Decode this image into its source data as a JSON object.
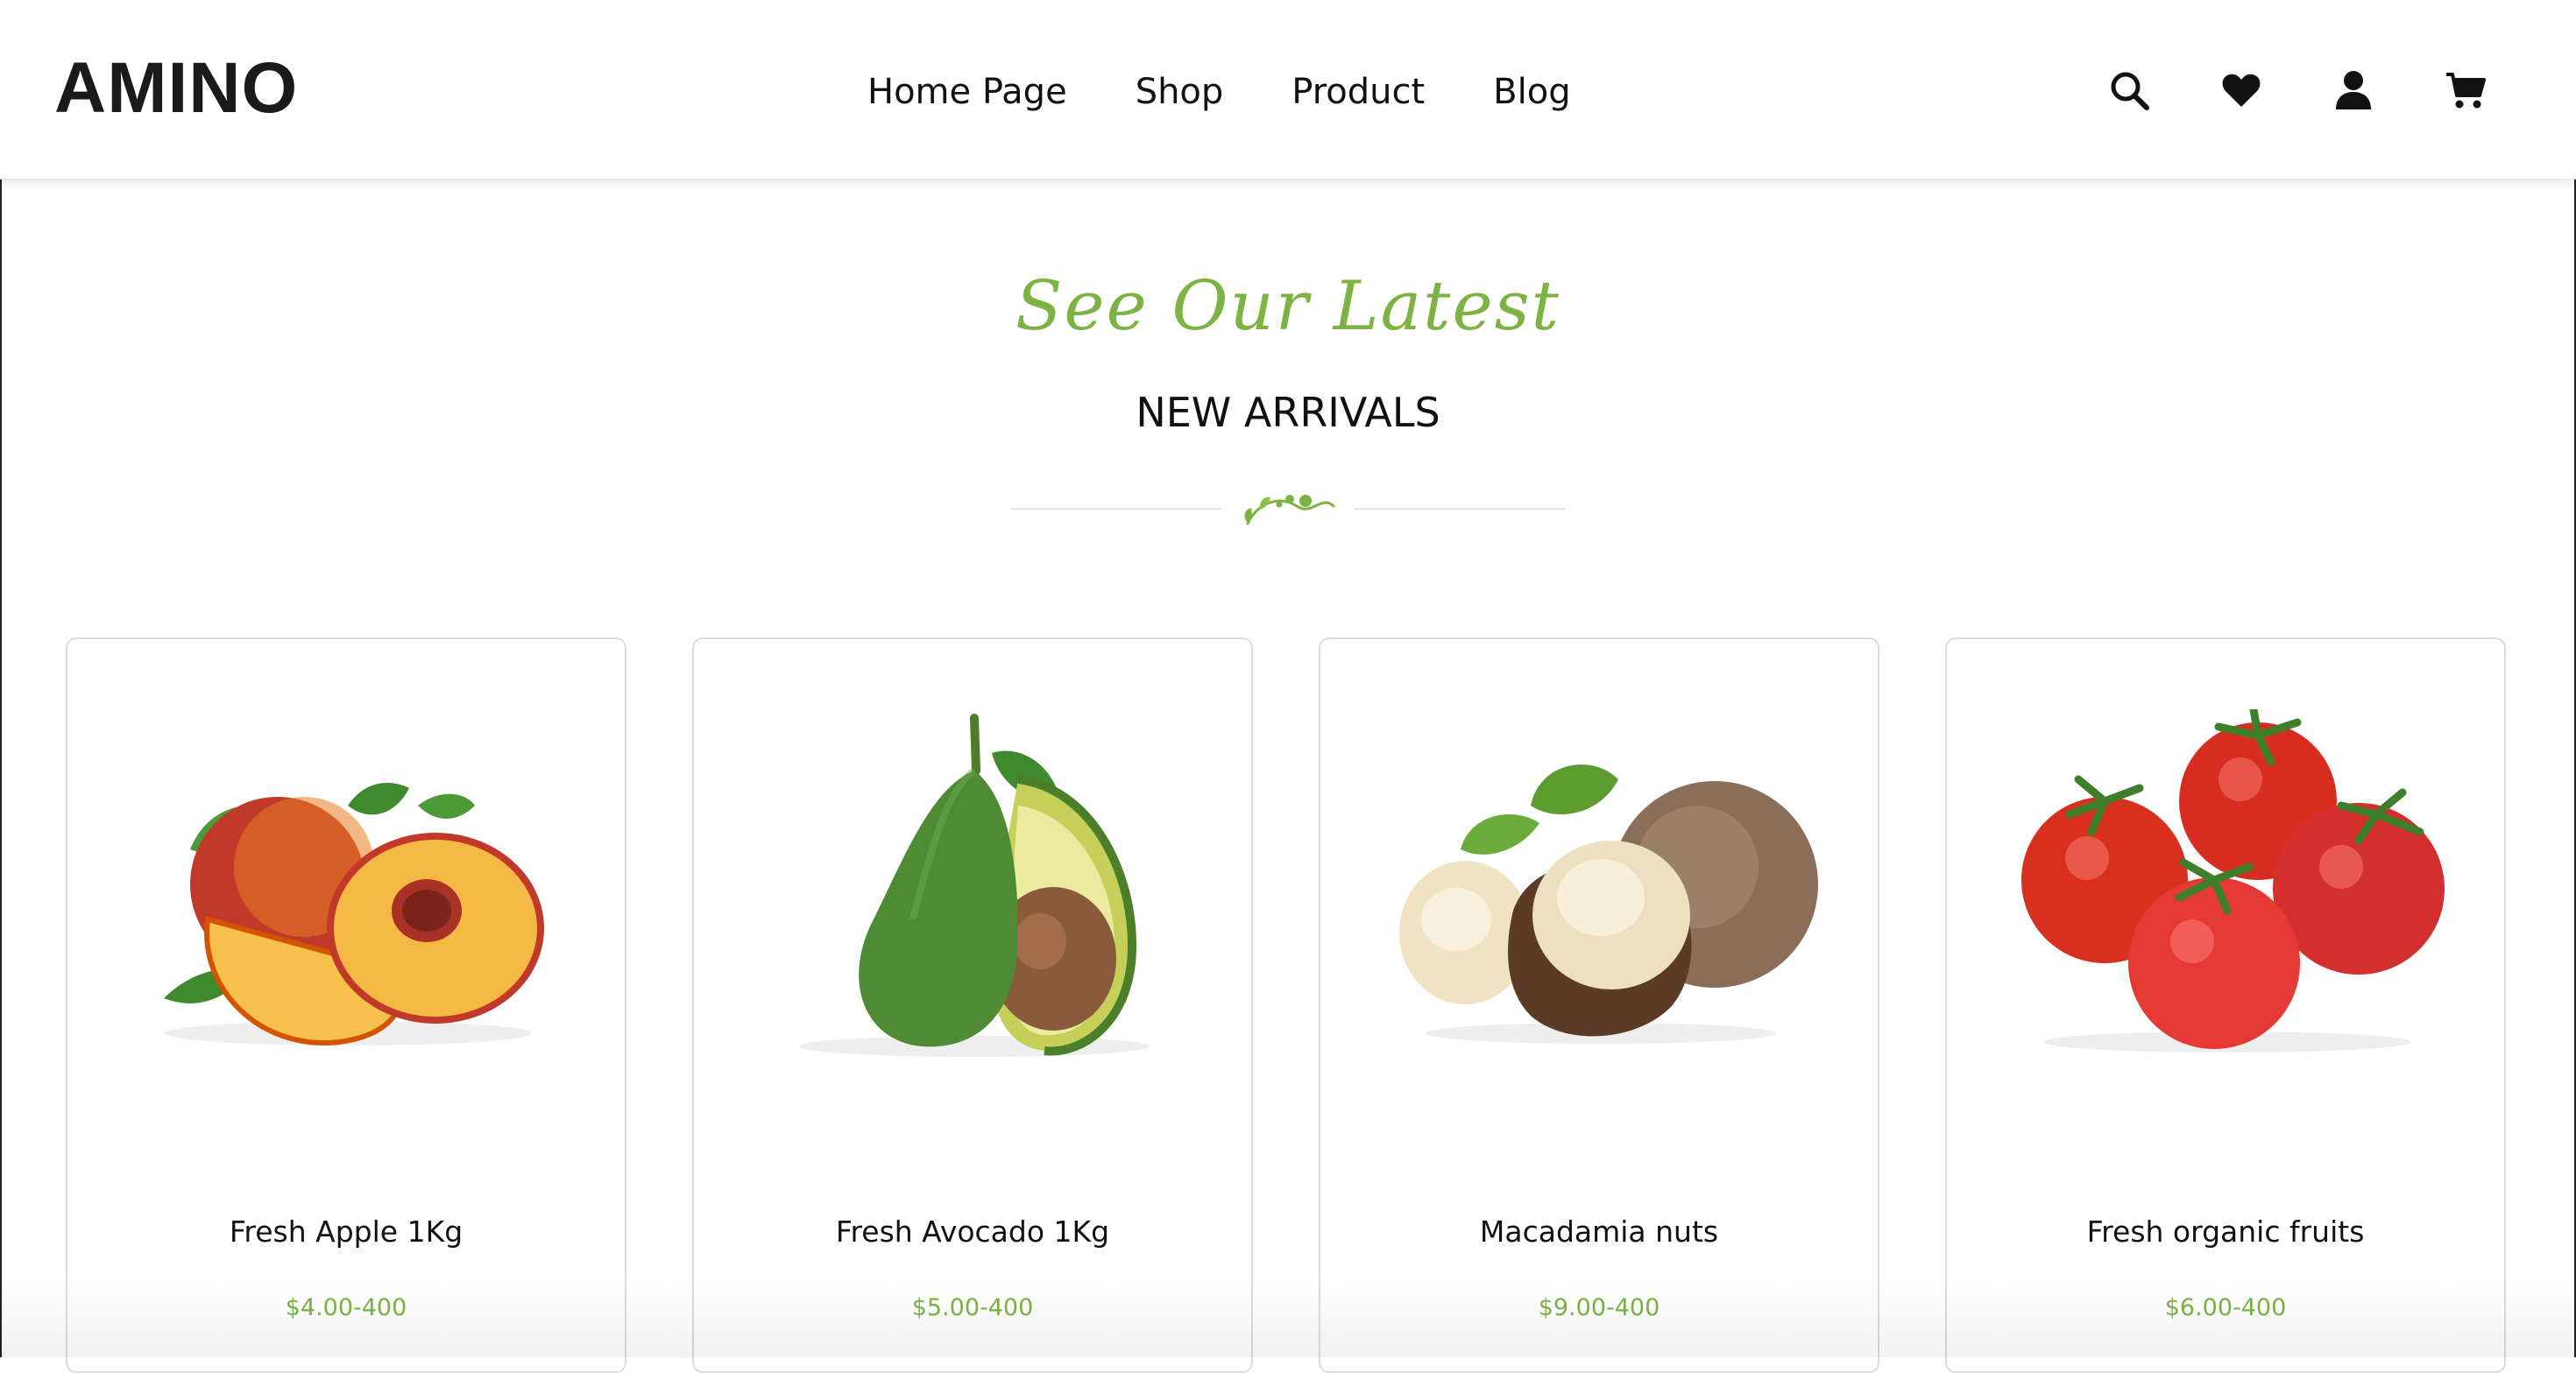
{
  "header": {
    "logo": "AMINO",
    "nav": [
      {
        "label": "Home Page"
      },
      {
        "label": "Shop"
      },
      {
        "label": "Product"
      },
      {
        "label": "Blog"
      }
    ],
    "icons": [
      "search-icon",
      "heart-icon",
      "user-icon",
      "cart-icon"
    ]
  },
  "section": {
    "subtitle": "See Our Latest",
    "title": "NEW ARRIVALS"
  },
  "products": [
    {
      "name": "Fresh Apple 1Kg",
      "price": "$4.00-400",
      "image": "peach"
    },
    {
      "name": "Fresh Avocado 1Kg",
      "price": "$5.00-400",
      "image": "avocado"
    },
    {
      "name": "Macadamia nuts",
      "price": "$9.00-400",
      "image": "macadamia"
    },
    {
      "name": "Fresh organic fruits",
      "price": "$6.00-400",
      "image": "tomatoes"
    }
  ],
  "colors": {
    "accent": "#7cb342",
    "text": "#111111",
    "border": "#dcdcdc"
  }
}
